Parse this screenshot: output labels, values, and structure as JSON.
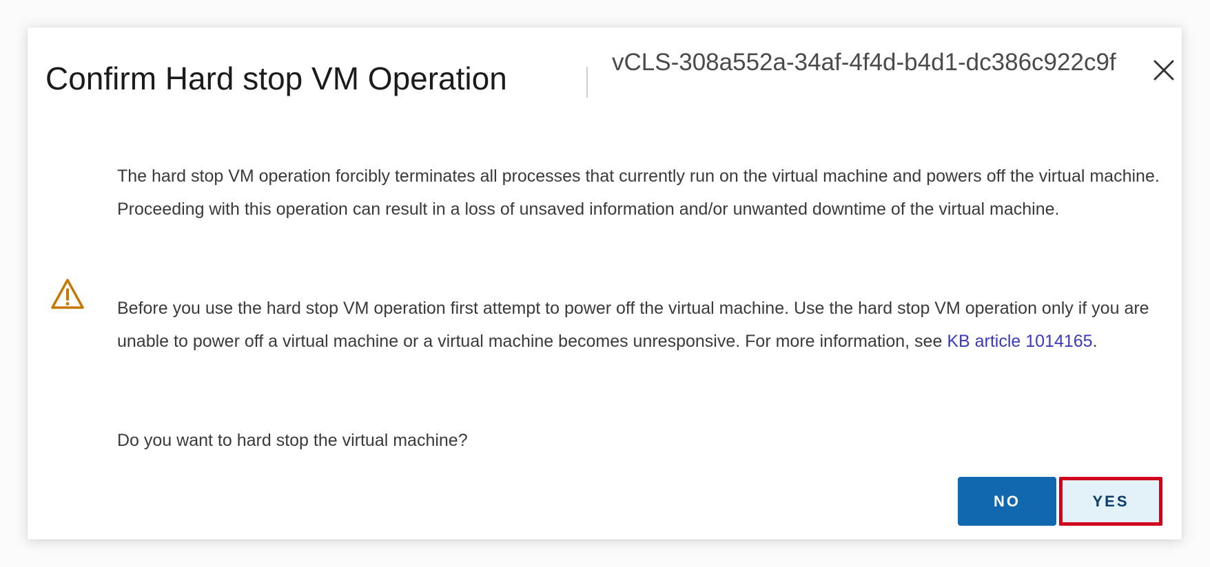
{
  "dialog": {
    "title": "Confirm Hard stop VM Operation",
    "vm_name": "vCLS-308a552a-34af-4f4d-b4d1-dc386c922c9f",
    "close_icon": "close-icon"
  },
  "content": {
    "description": "The hard stop VM operation forcibly terminates all processes that currently run on the virtual machine and powers off the virtual machine. Proceeding with this operation can result in a loss of unsaved information and/or unwanted downtime of the virtual machine.",
    "warning_icon": "warning-triangle-icon",
    "warning_text_before_link": "Before you use the hard stop VM operation first attempt to power off the virtual machine. Use the hard stop VM operation only if you are unable to power off a virtual machine or a virtual machine becomes unresponsive. For more information, see ",
    "warning_link_text": "KB article 1014165",
    "warning_text_after_link": ".",
    "question": "Do you want to hard stop the virtual machine?"
  },
  "buttons": {
    "no_label": "NO",
    "yes_label": "YES"
  },
  "colors": {
    "primary_button": "#0f67ae",
    "secondary_button_bg": "#e3f2f8",
    "highlight_border": "#d0021b",
    "warning_icon": "#c77700",
    "link": "#3a3ac0"
  }
}
